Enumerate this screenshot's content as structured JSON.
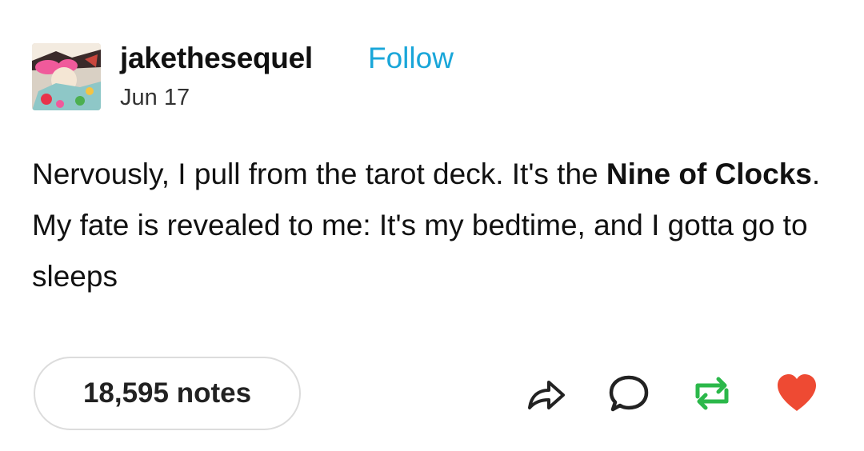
{
  "post": {
    "username": "jakethesequel",
    "follow_label": "Follow",
    "date": "Jun 17",
    "body": {
      "part1": "Nervously, I pull from the tarot deck. It's the ",
      "bold": "Nine of Clocks",
      "part2": ". My fate is revealed to me: It's my bedtime, and I gotta go to sleeps"
    },
    "notes_label": "18,595 notes"
  },
  "actions": {
    "share_icon": "share-arrow-icon",
    "reply_icon": "speech-bubble-icon",
    "reblog_icon": "reblog-icon",
    "like_icon": "heart-icon"
  },
  "colors": {
    "follow": "#19a6d9",
    "reblog": "#2bb84a",
    "like": "#ee4a33"
  }
}
